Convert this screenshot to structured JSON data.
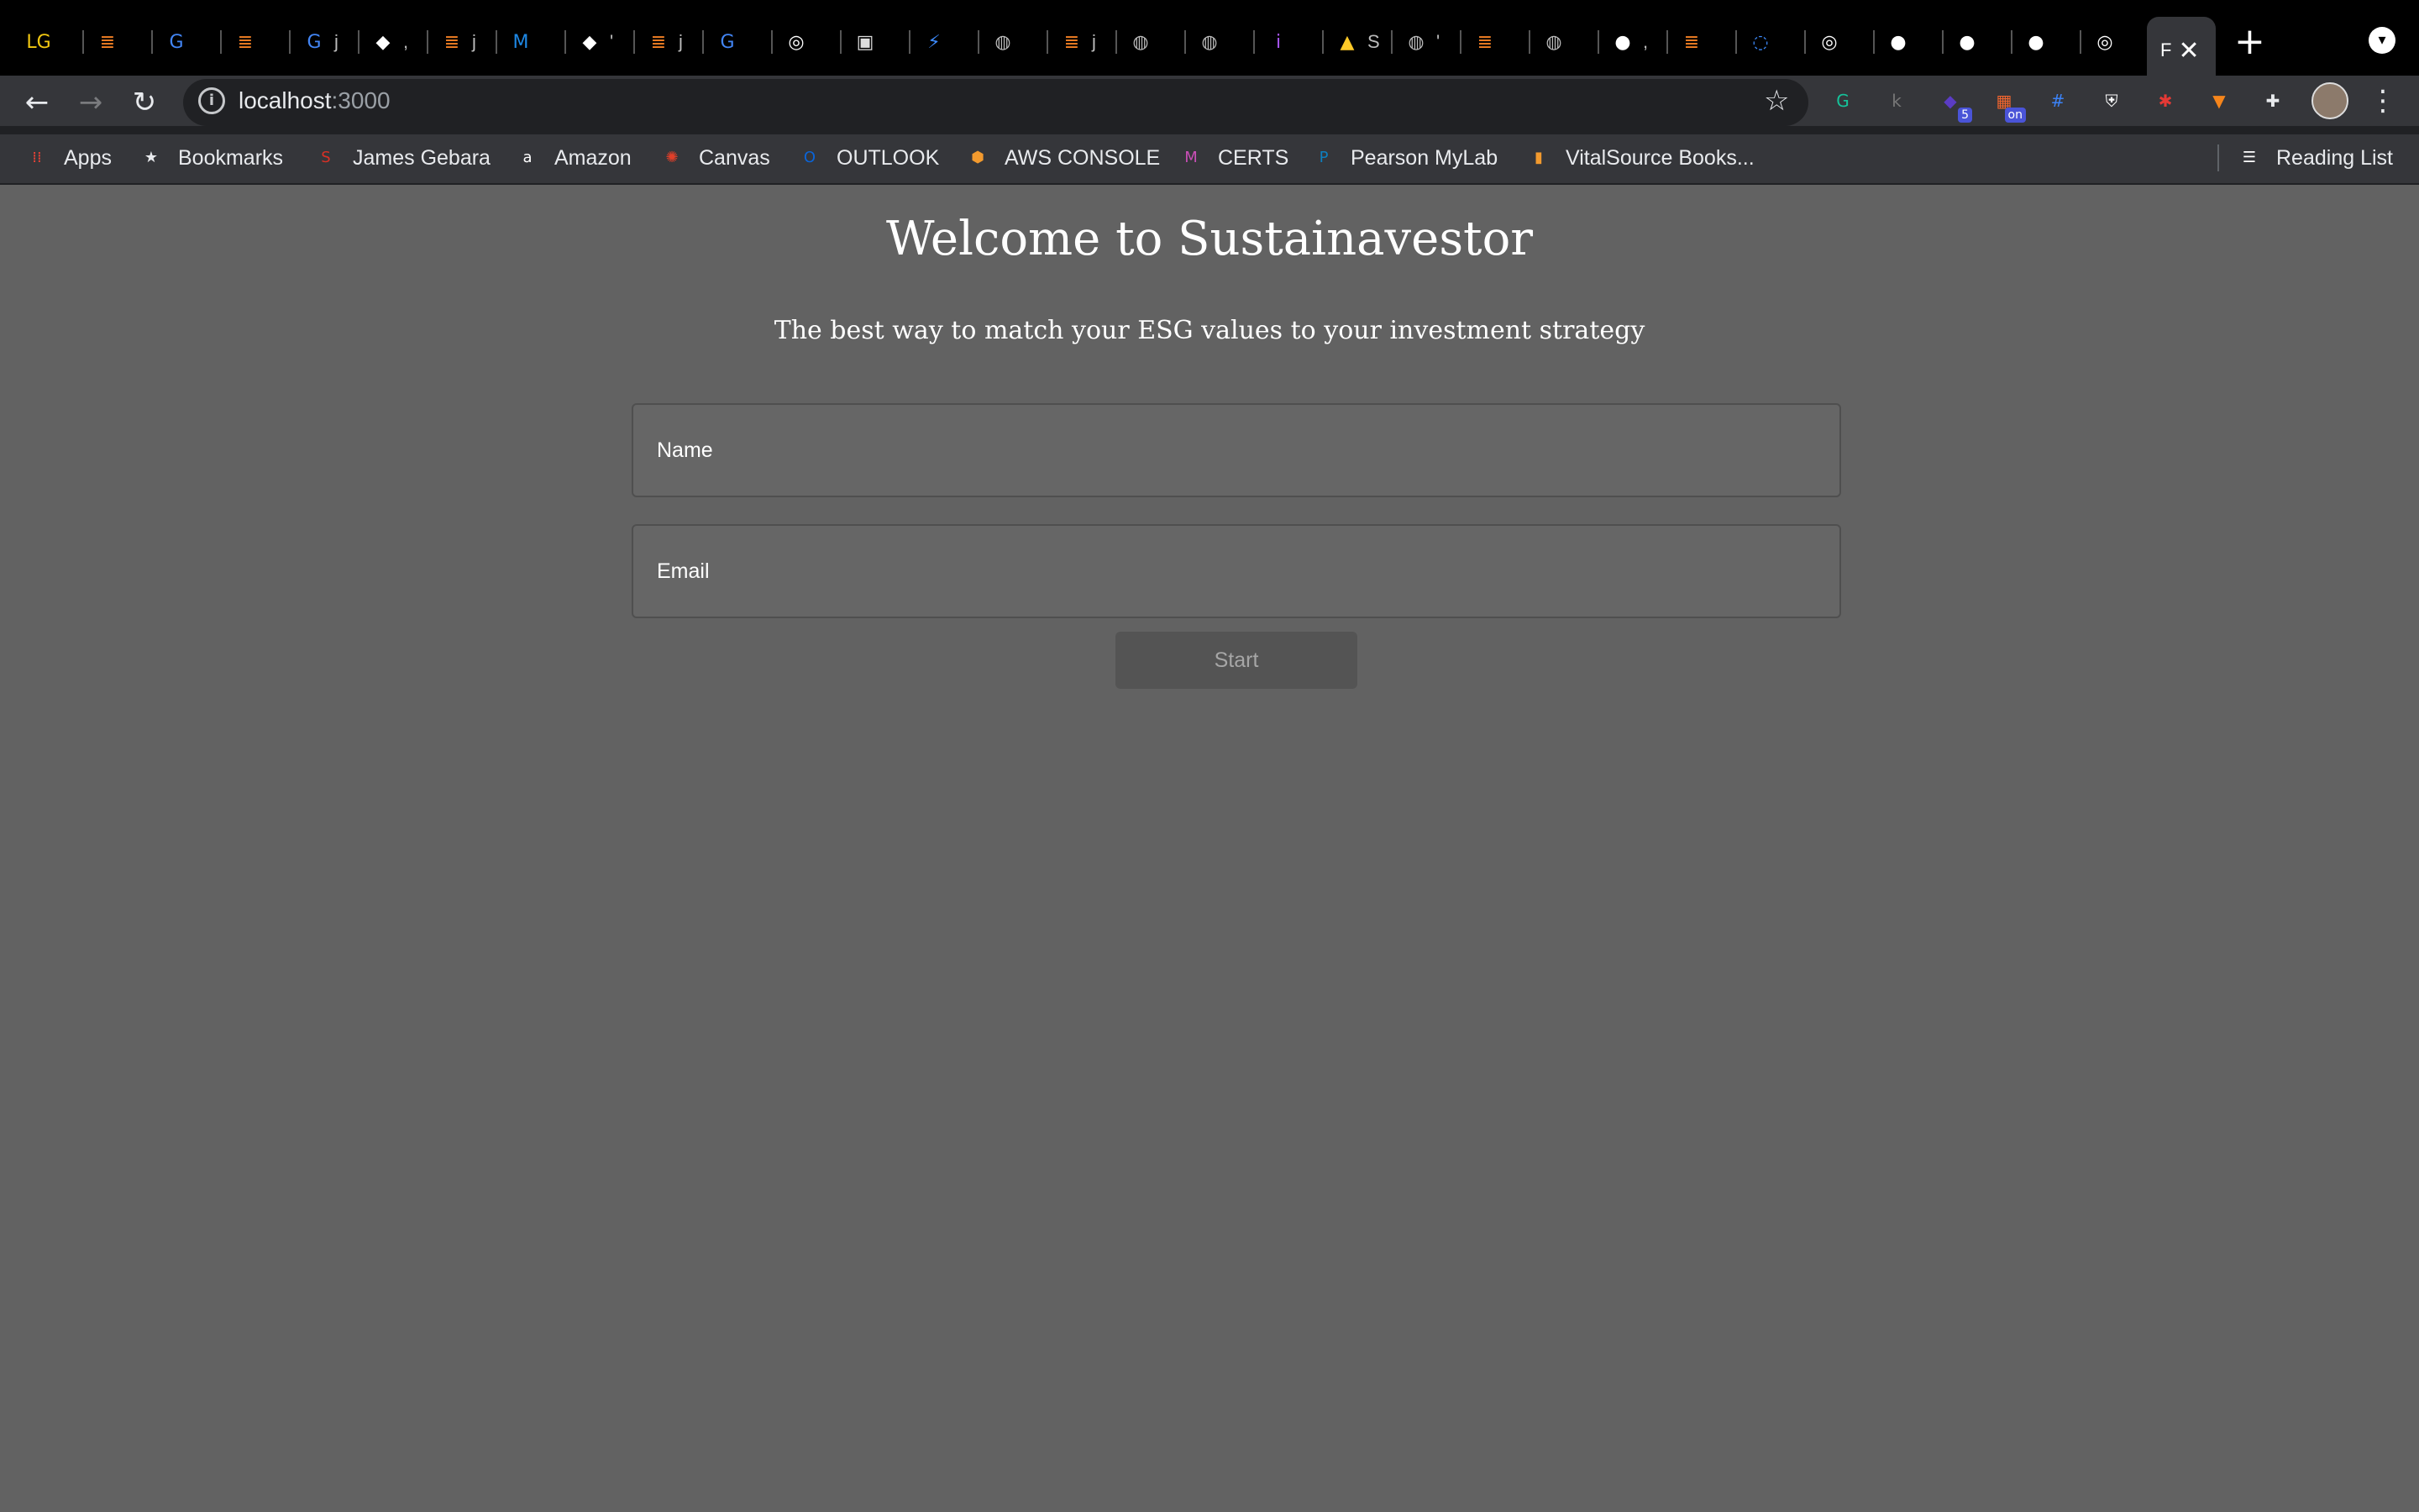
{
  "browser": {
    "tabs": [
      {
        "icon": "letters-lg-icon",
        "glyph": "LG",
        "color": "#f2c811",
        "text": ""
      },
      {
        "icon": "stackoverflow-icon",
        "glyph": "≣",
        "color": "#f48024",
        "text": ""
      },
      {
        "icon": "google-icon",
        "glyph": "G",
        "color": "#4285f4",
        "text": ""
      },
      {
        "icon": "stackoverflow-icon",
        "glyph": "≣",
        "color": "#f48024",
        "text": ""
      },
      {
        "icon": "google-icon",
        "glyph": "G",
        "color": "#4285f4",
        "text": "j"
      },
      {
        "icon": "bird-icon",
        "glyph": "◆",
        "color": "#ffffff",
        "text": ","
      },
      {
        "icon": "stackoverflow-icon",
        "glyph": "≣",
        "color": "#f48024",
        "text": "j"
      },
      {
        "icon": "mui-icon",
        "glyph": "M",
        "color": "#1e88e5",
        "text": ""
      },
      {
        "icon": "bird-icon",
        "glyph": "◆",
        "color": "#ffffff",
        "text": "'"
      },
      {
        "icon": "stackoverflow-icon",
        "glyph": "≣",
        "color": "#f48024",
        "text": "j"
      },
      {
        "icon": "google-icon",
        "glyph": "G",
        "color": "#4285f4",
        "text": ""
      },
      {
        "icon": "chrome-icon",
        "glyph": "◎",
        "color": "#ffffff",
        "text": ""
      },
      {
        "icon": "image-icon",
        "glyph": "▣",
        "color": "#dddddd",
        "text": ""
      },
      {
        "icon": "lightning-icon",
        "glyph": "⚡",
        "color": "#3d8bfd",
        "text": ""
      },
      {
        "icon": "globe-icon",
        "glyph": "◍",
        "color": "#bbbbbb",
        "text": ""
      },
      {
        "icon": "stackoverflow-icon",
        "glyph": "≣",
        "color": "#f48024",
        "text": "j"
      },
      {
        "icon": "globe-icon",
        "glyph": "◍",
        "color": "#bbbbbb",
        "text": ""
      },
      {
        "icon": "globe-icon",
        "glyph": "◍",
        "color": "#bbbbbb",
        "text": ""
      },
      {
        "icon": "info-icon",
        "glyph": "i",
        "color": "#a855f7",
        "text": ""
      },
      {
        "icon": "firebase-icon",
        "glyph": "▲",
        "color": "#ffca28",
        "text": "S"
      },
      {
        "icon": "globe-icon",
        "glyph": "◍",
        "color": "#bbbbbb",
        "text": "'"
      },
      {
        "icon": "stackoverflow-icon",
        "glyph": "≣",
        "color": "#f48024",
        "text": ""
      },
      {
        "icon": "globe-icon",
        "glyph": "◍",
        "color": "#bbbbbb",
        "text": ""
      },
      {
        "icon": "github-icon",
        "glyph": "●",
        "color": "#ffffff",
        "text": ","
      },
      {
        "icon": "stackoverflow-icon",
        "glyph": "≣",
        "color": "#f48024",
        "text": ""
      },
      {
        "icon": "loading-icon",
        "glyph": "◌",
        "color": "#3d8bfd",
        "text": ""
      },
      {
        "icon": "chrome-icon",
        "glyph": "◎",
        "color": "#ffffff",
        "text": ""
      },
      {
        "icon": "github-icon",
        "glyph": "●",
        "color": "#ffffff",
        "text": ""
      },
      {
        "icon": "github-icon",
        "glyph": "●",
        "color": "#ffffff",
        "text": ""
      },
      {
        "icon": "github-icon",
        "glyph": "●",
        "color": "#ffffff",
        "text": ""
      },
      {
        "icon": "chrome-icon",
        "glyph": "◎",
        "color": "#ffffff",
        "text": ""
      }
    ],
    "active_tab": {
      "text": "F",
      "close": "✕"
    },
    "new_tab": "+",
    "url_host": "localhost",
    "url_port": ":3000",
    "extensions": [
      {
        "name": "grammarly-icon",
        "glyph": "G",
        "color": "#15c39a",
        "badge": ""
      },
      {
        "name": "extension-k-icon",
        "glyph": "k",
        "color": "#777777",
        "badge": ""
      },
      {
        "name": "extension-box-icon",
        "glyph": "◆",
        "color": "#5b3cc4",
        "badge": "5"
      },
      {
        "name": "extension-on-icon",
        "glyph": "▦",
        "color": "#f0652f",
        "badge": "on"
      },
      {
        "name": "extension-grid-icon",
        "glyph": "#",
        "color": "#3b82f6",
        "badge": ""
      },
      {
        "name": "shield-icon",
        "glyph": "⛨",
        "color": "#ffffff",
        "badge": ""
      },
      {
        "name": "extension-red-icon",
        "glyph": "✱",
        "color": "#e53935",
        "badge": ""
      },
      {
        "name": "metamask-icon",
        "glyph": "▼",
        "color": "#f6851b",
        "badge": ""
      },
      {
        "name": "puzzle-icon",
        "glyph": "✚",
        "color": "#e8eaed",
        "badge": ""
      }
    ],
    "bookmarks": [
      {
        "label": "Apps",
        "icon": "apps-grid-icon",
        "glyph": "⁞⁞",
        "color": "#e94235"
      },
      {
        "label": "Bookmarks",
        "icon": "star-icon",
        "glyph": "★",
        "color": "#e8eaed"
      },
      {
        "label": "James Gebara",
        "icon": "bookmark-jg-icon",
        "glyph": "S",
        "color": "#d93025"
      },
      {
        "label": "Amazon",
        "icon": "amazon-icon",
        "glyph": "a",
        "color": "#ffffff"
      },
      {
        "label": "Canvas",
        "icon": "canvas-icon",
        "glyph": "✺",
        "color": "#e13f29"
      },
      {
        "label": "OUTLOOK",
        "icon": "outlook-icon",
        "glyph": "O",
        "color": "#0a64d8"
      },
      {
        "label": "AWS CONSOLE",
        "icon": "aws-box-icon",
        "glyph": "⬢",
        "color": "#f29a2e"
      },
      {
        "label": "CERTS",
        "icon": "certs-icon",
        "glyph": "M",
        "color": "#c94fb6"
      },
      {
        "label": "Pearson MyLab",
        "icon": "pearson-icon",
        "glyph": "P",
        "color": "#0d7fbf"
      },
      {
        "label": "VitalSource Books...",
        "icon": "vitalsource-icon",
        "glyph": "▮",
        "color": "#f29a2e"
      }
    ],
    "reading_list": "Reading List"
  },
  "page": {
    "title": "Welcome to Sustainavestor",
    "subtitle": "The best way to match your ESG values to your investment strategy",
    "name_placeholder": "Name",
    "email_placeholder": "Email",
    "start_label": "Start"
  },
  "colors": {
    "page_background": "#626262",
    "chrome_background": "#35363a",
    "start_button_background": "#545454"
  }
}
